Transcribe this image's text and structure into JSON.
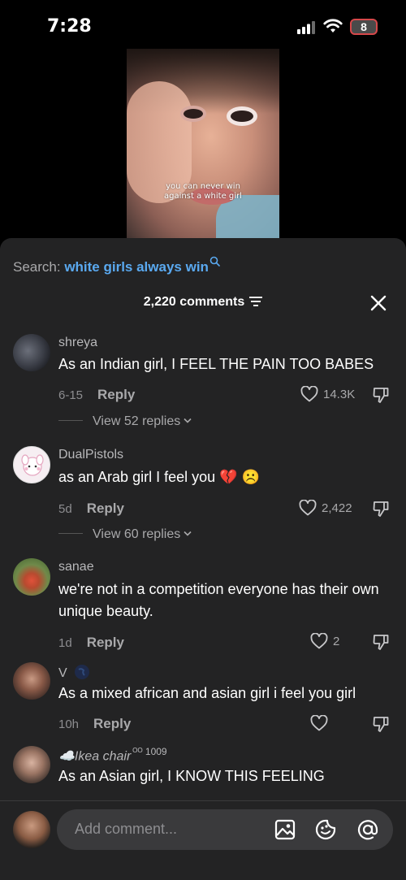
{
  "status_bar": {
    "time": "7:28",
    "battery": "8",
    "icons": [
      "signal-icon",
      "wifi-icon",
      "battery-icon"
    ]
  },
  "video": {
    "caption_line1": "you can never win",
    "caption_line2": "against a white girl"
  },
  "search": {
    "label": "Search: ",
    "query": "white girls always win",
    "icon": "search-icon"
  },
  "comments_header": {
    "count": "2,220 comments",
    "icons": [
      "filter-icon",
      "close-icon"
    ]
  },
  "comments": [
    {
      "user": "shreya",
      "text": "As an Indian girl, I FEEL THE PAIN TOO BABES",
      "time": "6-15",
      "reply": "Reply",
      "likes": "14.3K",
      "view_replies": "View 52 replies"
    },
    {
      "user": "DualPistols",
      "text": "as an Arab girl I feel you 💔 ☹️",
      "time": "5d",
      "reply": "Reply",
      "likes": "2,422",
      "view_replies": "View 60 replies"
    },
    {
      "user": "sanae",
      "text": "we're not in a competition everyone has their own unique beauty.",
      "time": "1d",
      "reply": "Reply",
      "likes": "2"
    },
    {
      "user": "V",
      "text": "As a mixed african and asian girl i feel you girl",
      "time": "10h",
      "reply": "Reply",
      "likes": ""
    },
    {
      "user": "☁️Ikea chair",
      "user_suffix": "ᴼᴼ 1009",
      "text": "As an Asian girl, I KNOW THIS FEELING"
    }
  ],
  "composer": {
    "placeholder": "Add comment...",
    "icons": [
      "image-icon",
      "emoji-icon",
      "mention-icon"
    ]
  },
  "colors": {
    "sheet_bg": "#232324",
    "accent_blue": "#5aa9f0",
    "battery_red": "#d6484a"
  }
}
